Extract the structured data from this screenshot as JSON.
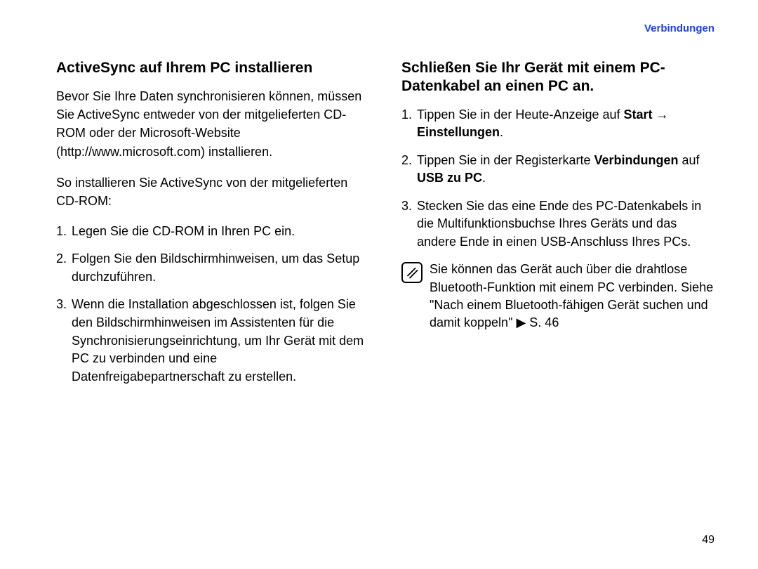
{
  "header": {
    "link": "Verbindungen"
  },
  "left": {
    "heading": "ActiveSync auf Ihrem PC installieren",
    "intro": "Bevor Sie Ihre Daten synchronisieren können, müssen Sie ActiveSync entweder von der mitgelieferten CD-ROM oder der Microsoft-Website (http://www.microsoft.com) installieren.",
    "lead": "So installieren Sie ActiveSync von der mitgelieferten CD-ROM:",
    "steps": [
      "Legen Sie die CD-ROM in Ihren PC ein.",
      "Folgen Sie den Bildschirmhinweisen, um das Setup durchzuführen.",
      "Wenn die Installation abgeschlossen ist, folgen Sie den Bildschirmhinweisen im Assistenten für die Synchronisierungseinrichtung, um Ihr Gerät mit dem PC zu verbinden und eine Datenfreigabepartnerschaft zu erstellen."
    ]
  },
  "right": {
    "heading": "Schließen Sie Ihr Gerät mit einem PC-Datenkabel an einen PC an.",
    "steps": {
      "s1a": "Tippen Sie in der Heute-Anzeige auf ",
      "s1b": "Start → Einstellungen",
      "s1c": ".",
      "s2a": "Tippen Sie in der Registerkarte ",
      "s2b": "Verbindungen",
      "s2c": " auf ",
      "s2d": "USB zu PC",
      "s2e": ".",
      "s3": "Stecken Sie das eine Ende des PC-Datenkabels in die Multifunktionsbuchse Ihres Geräts und das andere Ende in einen USB-Anschluss Ihres PCs."
    },
    "note": "Sie können das Gerät auch über die drahtlose Bluetooth-Funktion mit einem PC verbinden. Siehe \"Nach einem Bluetooth-fähigen Gerät suchen und damit koppeln\" ▶ S. 46"
  },
  "page": "49"
}
